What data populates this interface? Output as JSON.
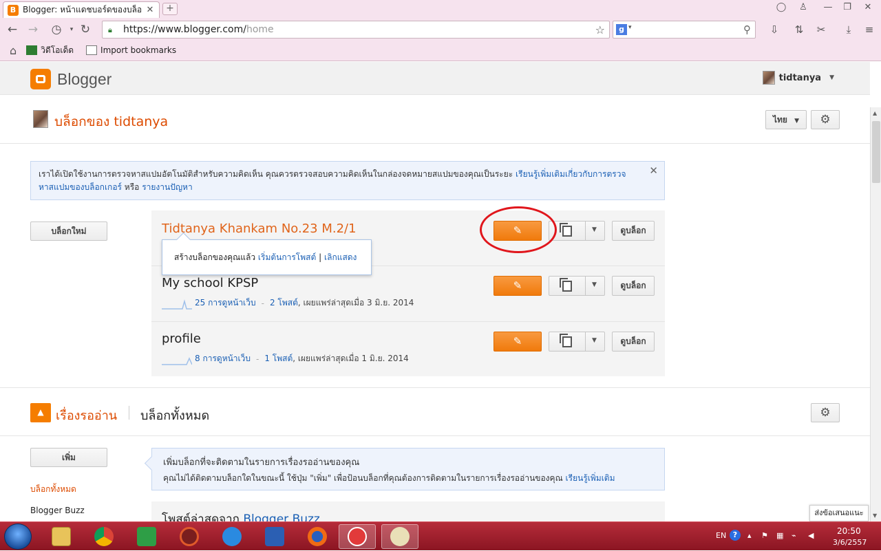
{
  "browser": {
    "tab_title": "Blogger: หน้าแดชบอร์ดของบล็อก",
    "tab_favicon": "blogger-icon",
    "url_host": "https://www.blogger.com/",
    "url_path": "home",
    "bookmarks": [
      {
        "label": "วิดีโอเด็ด",
        "icon": "video-icon"
      },
      {
        "label": "Import bookmarks",
        "icon": "import-icon"
      }
    ]
  },
  "header": {
    "app_name": "Blogger",
    "username": "tidtanya"
  },
  "blogs_section": {
    "title": "บล็อกของ tidtanya",
    "language": "ไทย",
    "notice_text": "เราได้เปิดใช้งานการตรวจหาสแปมอัตโนมัติสำหรับความคิดเห็น คุณควรตรวจสอบความคิดเห็นในกล่องจดหมายสแปมของคุณเป็นระยะ",
    "notice_link1": "เรียนรู้เพิ่มเติมเกี่ยวกับการตรวจหาสแปมของบล็อกเกอร์",
    "notice_or": "หรือ",
    "notice_link2": "รายงานปัญหา",
    "new_blog_label": "บล็อกใหม่",
    "view_blog_label": "ดูบล็อก",
    "blogs": [
      {
        "title": "Tidtanya Khankam No.23 M.2/1",
        "pageviews": "",
        "posts": "",
        "published": ""
      },
      {
        "title": "My school KPSP",
        "pageviews": "25 การดูหน้าเว็บ",
        "posts": "2 โพสต์",
        "published": ", เผยแพร่ล่าสุดเมื่อ 3 มิ.ย. 2014"
      },
      {
        "title": "profile",
        "pageviews": "8 การดูหน้าเว็บ",
        "posts": "1 โพสต์",
        "published": ", เผยแพร่ล่าสุดเมื่อ 1 มิ.ย. 2014"
      }
    ],
    "tooltip_text": "สร้างบล็อกของคุณแล้ว",
    "tooltip_link1": "เริ่มต้นการโพสต์",
    "tooltip_sep": "|",
    "tooltip_link2": "เลิกแสดง"
  },
  "reading_list": {
    "title": "เรื่องรออ่าน",
    "subtitle": "บล็อกทั้งหมด",
    "add_label": "เพิ่ม",
    "side_links": [
      "บล็อกทั้งหมด",
      "Blogger Buzz"
    ],
    "tip_line1": "เพิ่มบล็อกที่จะติดตามในรายการเรื่องรออ่านของคุณ",
    "tip_line2": "คุณไม่ได้ติดตามบล็อกใดในขณะนี้ ใช้ปุ่ม \"เพิ่ม\" เพื่อป้อนบล็อกที่คุณต้องการติดตามในรายการเรื่องรออ่านของคุณ",
    "tip_link": "เรียนรู้เพิ่มเติม",
    "latest_prefix": "โพสต์ล่าสุดจาก",
    "latest_link": "Blogger Buzz"
  },
  "feedback_label": "ส่งข้อเสนอแนะ",
  "taskbar": {
    "lang": "EN",
    "time": "20:50",
    "date": "3/6/2557",
    "apps": [
      "file-explorer-icon",
      "chrome-icon",
      "hao123-icon",
      "app-icon",
      "ie-icon",
      "word-icon",
      "firefox-icon",
      "sogou-icon",
      "paint-icon"
    ]
  },
  "colors": {
    "blogger_orange": "#f57d00",
    "link_blue": "#1a5fb4",
    "highlight_red": "#e0161c",
    "title_orange": "#dd4b00"
  }
}
